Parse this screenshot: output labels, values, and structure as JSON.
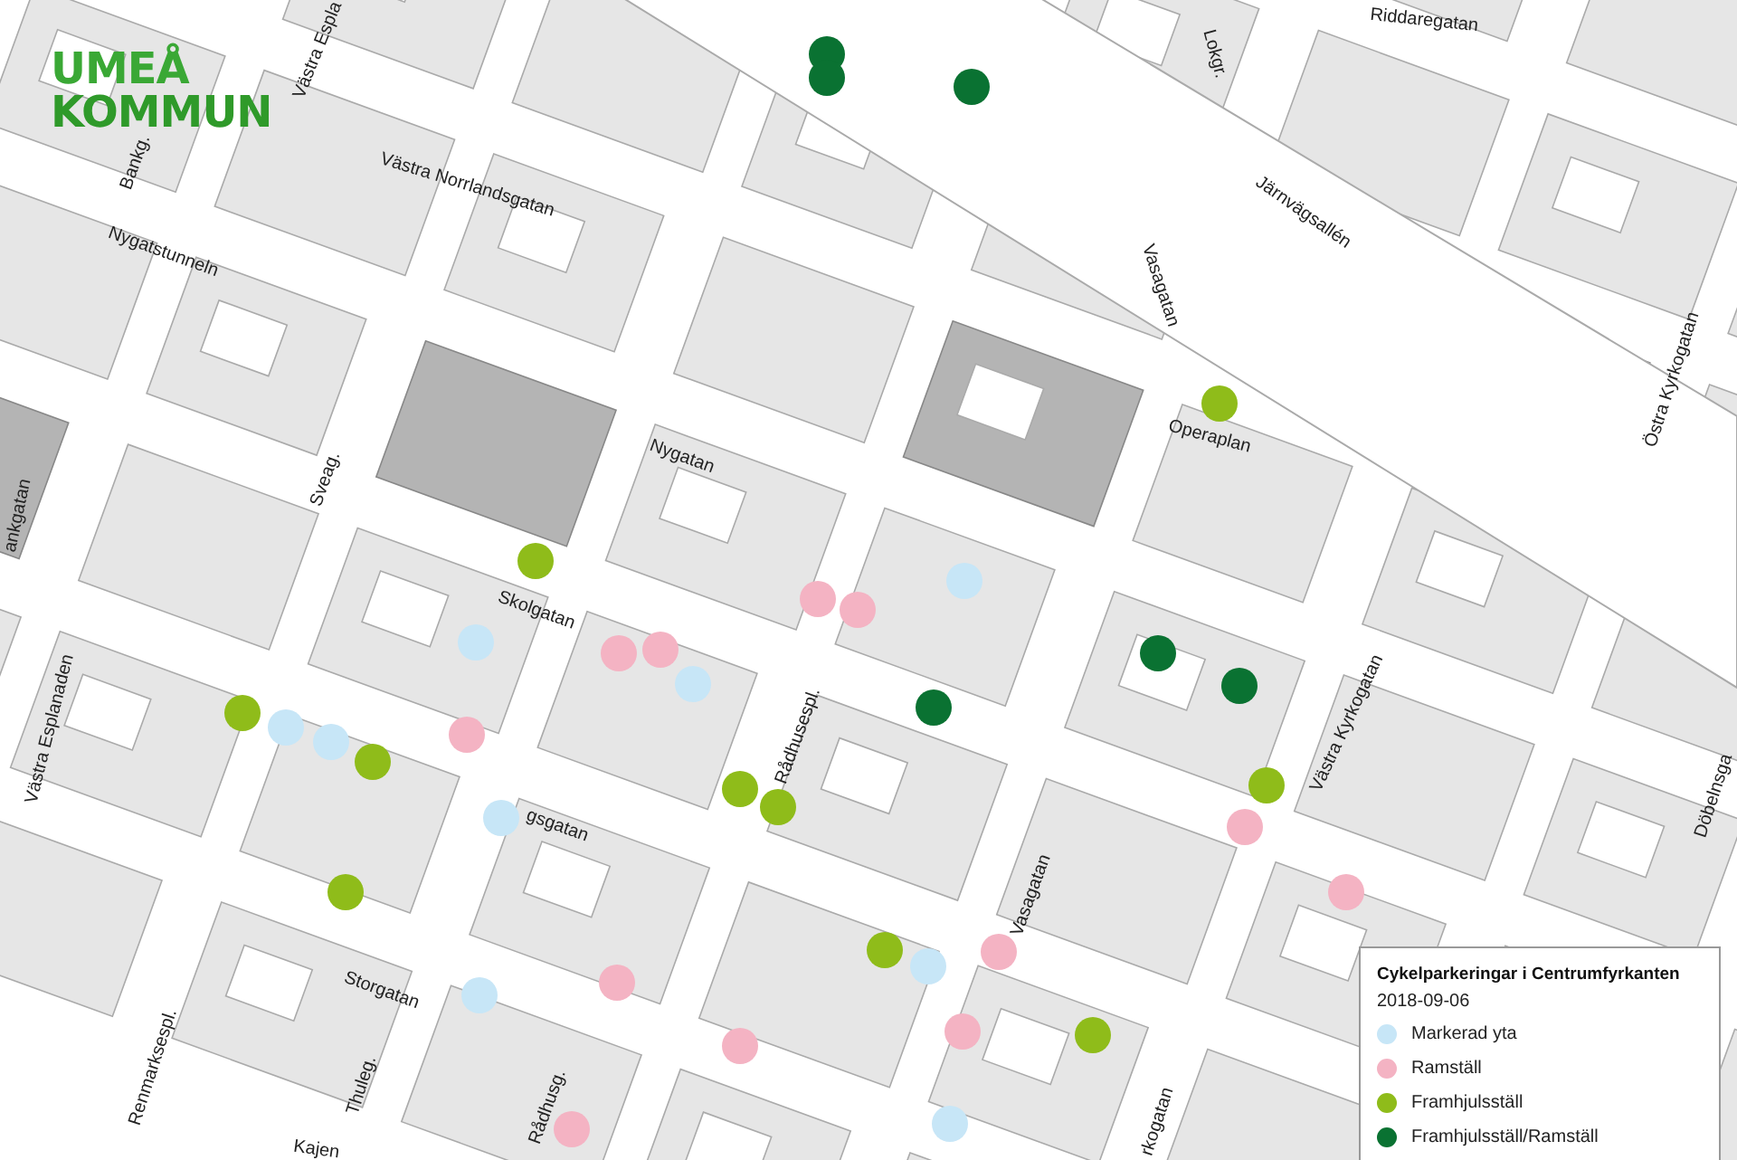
{
  "logo": {
    "lines": [
      "UMEÅ",
      "KOMMUN"
    ]
  },
  "streets": [
    "Riddaregatan",
    "Västra Espla",
    "Västra Norrlandsgatan",
    "Bankg.",
    "Nygatstunneln",
    "Sveag.",
    "Nygatan",
    "Skolgatan",
    "Västra Esplanaden",
    "gsgatan",
    "Rådhusespl.",
    "Storgatan",
    "Renmarksespl.",
    "Thuleg.",
    "Kajen",
    "Rådhusg.",
    "Vasagatan",
    "Vasagatan",
    "Järnvägsallén",
    "Lokgr.",
    "Östra Kyrkogatan",
    "Operaplan",
    "Västra Kyrkogatan",
    "Döbelnsga",
    "rkogatan",
    "ankgatan"
  ],
  "points": [
    {
      "color": "#0a7232"
    },
    {
      "color": "#0a7232"
    },
    {
      "color": "#0a7232"
    },
    {
      "color": "#0a7232"
    },
    {
      "color": "#0a7232"
    },
    {
      "color": "#0a7232"
    },
    {
      "color": "#8fbc1a"
    },
    {
      "color": "#8fbc1a"
    },
    {
      "color": "#8fbc1a"
    },
    {
      "color": "#8fbc1a"
    },
    {
      "color": "#8fbc1a"
    },
    {
      "color": "#8fbc1a"
    },
    {
      "color": "#8fbc1a"
    },
    {
      "color": "#8fbc1a"
    },
    {
      "color": "#8fbc1a"
    },
    {
      "color": "#8fbc1a"
    },
    {
      "color": "#f4b3c3"
    },
    {
      "color": "#f4b3c3"
    },
    {
      "color": "#f4b3c3"
    },
    {
      "color": "#f4b3c3"
    },
    {
      "color": "#f4b3c3"
    },
    {
      "color": "#f4b3c3"
    },
    {
      "color": "#f4b3c3"
    },
    {
      "color": "#f4b3c3"
    },
    {
      "color": "#f4b3c3"
    },
    {
      "color": "#f4b3c3"
    },
    {
      "color": "#f4b3c3"
    },
    {
      "color": "#f4b3c3"
    },
    {
      "color": "#c7e6f7"
    },
    {
      "color": "#c7e6f7"
    },
    {
      "color": "#c7e6f7"
    },
    {
      "color": "#c7e6f7"
    },
    {
      "color": "#c7e6f7"
    },
    {
      "color": "#c7e6f7"
    },
    {
      "color": "#c7e6f7"
    },
    {
      "color": "#c7e6f7"
    },
    {
      "color": "#c7e6f7"
    }
  ],
  "legend": {
    "title": "Cykelparkeringar i Centrumfyrkanten",
    "date": "2018-09-06",
    "items": [
      {
        "label": "Markerad yta",
        "color": "#c7e6f7"
      },
      {
        "label": "Ramställ",
        "color": "#f4b3c3"
      },
      {
        "label": "Framhjulsställ",
        "color": "#8fbc1a"
      },
      {
        "label": "Framhjulsställ/Ramställ",
        "color": "#0a7232"
      }
    ]
  }
}
